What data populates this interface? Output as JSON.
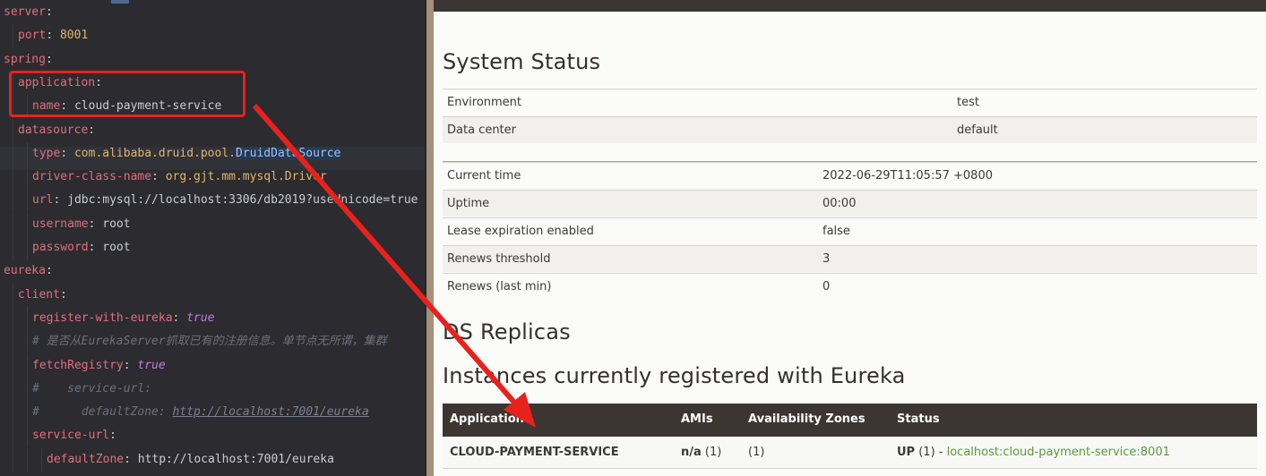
{
  "editor": {
    "lines": [
      {
        "indent": 0,
        "parts": [
          [
            "k",
            "server"
          ],
          [
            "s",
            ":"
          ]
        ]
      },
      {
        "indent": 1,
        "parts": [
          [
            "k",
            "port"
          ],
          [
            "s",
            ": "
          ],
          [
            "n",
            "8001"
          ]
        ]
      },
      {
        "indent": 0,
        "parts": [
          [
            "k",
            "spring"
          ],
          [
            "s",
            ":"
          ]
        ]
      },
      {
        "indent": 1,
        "parts": [
          [
            "k",
            "application"
          ],
          [
            "s",
            ":"
          ]
        ]
      },
      {
        "indent": 2,
        "parts": [
          [
            "k",
            "name"
          ],
          [
            "s",
            ": cloud-payment-service"
          ]
        ]
      },
      {
        "indent": 1,
        "parts": [
          [
            "k",
            "datasource"
          ],
          [
            "s",
            ":"
          ]
        ]
      },
      {
        "indent": 2,
        "parts": [
          [
            "k",
            "type"
          ],
          [
            "s",
            ": "
          ],
          [
            "p",
            "com.alibaba.druid.pool."
          ],
          [
            "hl",
            "DruidDataSource"
          ]
        ]
      },
      {
        "indent": 2,
        "parts": [
          [
            "k",
            "driver-class-name"
          ],
          [
            "s",
            ": "
          ],
          [
            "p",
            "org.gjt.mm.mysql.Driver"
          ]
        ]
      },
      {
        "indent": 2,
        "parts": [
          [
            "k",
            "url"
          ],
          [
            "s",
            ": jdbc:mysql://localhost:3306/db2019?useUnicode=true"
          ]
        ]
      },
      {
        "indent": 2,
        "parts": [
          [
            "k",
            "username"
          ],
          [
            "s",
            ": root"
          ]
        ]
      },
      {
        "indent": 2,
        "parts": [
          [
            "k",
            "password"
          ],
          [
            "s",
            ": root"
          ]
        ]
      },
      {
        "indent": 0,
        "parts": [
          [
            "k",
            "eureka"
          ],
          [
            "s",
            ":"
          ]
        ]
      },
      {
        "indent": 1,
        "parts": [
          [
            "k",
            "client"
          ],
          [
            "s",
            ":"
          ]
        ]
      },
      {
        "indent": 2,
        "parts": [
          [
            "k",
            "register-with-eureka"
          ],
          [
            "s",
            ": "
          ],
          [
            "b",
            "true"
          ]
        ]
      },
      {
        "indent": 2,
        "parts": [
          [
            "c",
            "# 是否从EurekaServer抓取已有的注册信息。单节点无所谓，集群"
          ]
        ]
      },
      {
        "indent": 2,
        "parts": [
          [
            "k",
            "fetchRegistry"
          ],
          [
            "s",
            ": "
          ],
          [
            "b",
            "true"
          ]
        ]
      },
      {
        "indent": 2,
        "parts": [
          [
            "c",
            "#    service-url:"
          ]
        ]
      },
      {
        "indent": 2,
        "parts": [
          [
            "c",
            "#      defaultZone: "
          ],
          [
            "cu",
            "http://localhost:7001/eureka"
          ]
        ]
      },
      {
        "indent": 2,
        "parts": [
          [
            "k",
            "service-url"
          ],
          [
            "s",
            ":"
          ]
        ]
      },
      {
        "indent": 3,
        "parts": [
          [
            "k",
            "defaultZone"
          ],
          [
            "s",
            ": http://localhost:7001/eureka"
          ]
        ]
      }
    ]
  },
  "system_status": {
    "title": "System Status",
    "env_rows": [
      {
        "label": "Environment",
        "value": "test"
      },
      {
        "label": "Data center",
        "value": "default"
      }
    ],
    "stat_rows": [
      {
        "label": "Current time",
        "value": "2022-06-29T11:05:57 +0800"
      },
      {
        "label": "Uptime",
        "value": "00:00"
      },
      {
        "label": "Lease expiration enabled",
        "value": "false"
      },
      {
        "label": "Renews threshold",
        "value": "3"
      },
      {
        "label": "Renews (last min)",
        "value": "0"
      }
    ]
  },
  "replicas": {
    "title": "DS Replicas"
  },
  "instances": {
    "title": "Instances currently registered with Eureka",
    "headers": [
      "Application",
      "AMIs",
      "Availability Zones",
      "Status"
    ],
    "row": {
      "application": "CLOUD-PAYMENT-SERVICE",
      "amis_bold": "n/a",
      "amis_count": " (1)",
      "zones": "(1)",
      "status_bold": "UP",
      "status_rest": " (1) - ",
      "status_link": "localhost:cloud-payment-service:8001"
    }
  },
  "colors": {
    "accent_red": "#e8211d",
    "header_dark": "#3b3632",
    "link_green": "#5a9a3a"
  }
}
